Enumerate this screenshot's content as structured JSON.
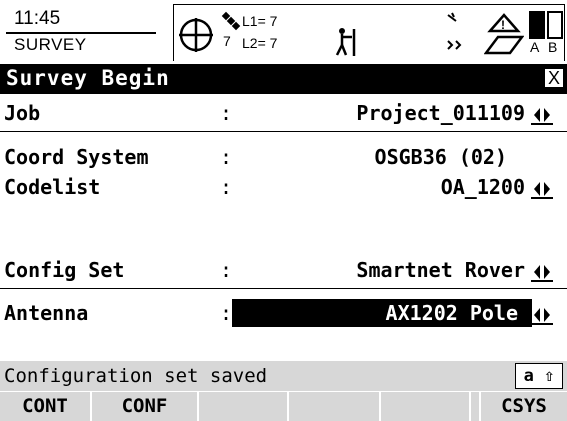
{
  "status": {
    "time": "11:45",
    "mode": "SURVEY",
    "sat_count": "7",
    "l1": "L1= 7",
    "l2": "L2= 7",
    "battery_a": "A",
    "battery_b": "B"
  },
  "title": "Survey Begin",
  "close": "X",
  "fields": {
    "job": {
      "label": "Job",
      "colon": ":",
      "value": "Project_011109"
    },
    "coord_system": {
      "label": "Coord System",
      "colon": ":",
      "value": "OSGB36 (02)"
    },
    "codelist": {
      "label": "Codelist",
      "colon": ":",
      "value": "OA_1200"
    },
    "config_set": {
      "label": "Config Set",
      "colon": ":",
      "value": "Smartnet Rover"
    },
    "antenna": {
      "label": "Antenna",
      "colon": ":",
      "value": "AX1202 Pole"
    }
  },
  "message": "Configuration set saved",
  "input_indicator": "a ⇧",
  "softkeys": [
    "CONT",
    "CONF",
    "",
    "",
    "",
    "",
    "CSYS"
  ],
  "icons": [
    "crosshair-icon",
    "satellite-icon",
    "surveyor-icon",
    "radio-icon",
    "warning-icon",
    "card-icon",
    "battery-icon"
  ]
}
